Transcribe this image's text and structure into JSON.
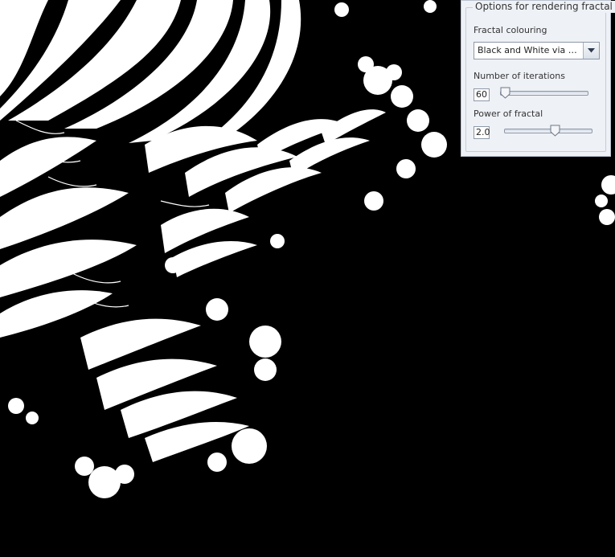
{
  "window": {
    "background": "#000000",
    "fractal_colors": {
      "primary": "#ffffff",
      "secondary": "#000000"
    }
  },
  "options_panel": {
    "title": "Options for rendering fractal",
    "colouring": {
      "label": "Fractal colouring",
      "selected": "Black and White via mo...",
      "arrow_icon": "chevron-down-icon"
    },
    "iterations": {
      "label": "Number of iterations",
      "value": "60",
      "slider_fraction": 0.0
    },
    "power": {
      "label": "Power of fractal",
      "value": "2.0",
      "slider_fraction": 0.6
    }
  }
}
